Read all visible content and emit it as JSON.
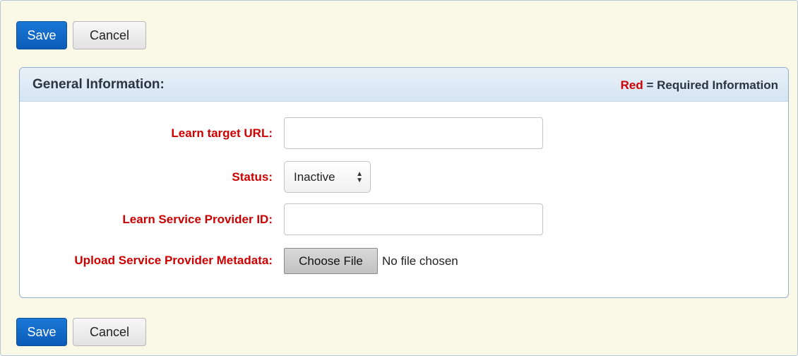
{
  "toolbar": {
    "save_label": "Save",
    "cancel_label": "Cancel"
  },
  "panel": {
    "title": "General Information:",
    "legend": {
      "red_word": "Red",
      "rest": " = Required Information"
    }
  },
  "fields": {
    "learn_target_url": {
      "label": "Learn target URL:",
      "value": ""
    },
    "status": {
      "label": "Status:",
      "selected": "Inactive"
    },
    "service_provider_id": {
      "label": "Learn Service Provider ID:",
      "value": ""
    },
    "metadata_upload": {
      "label": "Upload Service Provider Metadata:",
      "button_label": "Choose File",
      "status_text": "No file chosen"
    }
  },
  "colors": {
    "required": "#cc0000",
    "primary": "#0b5bb8",
    "background": "#faf8e6"
  }
}
